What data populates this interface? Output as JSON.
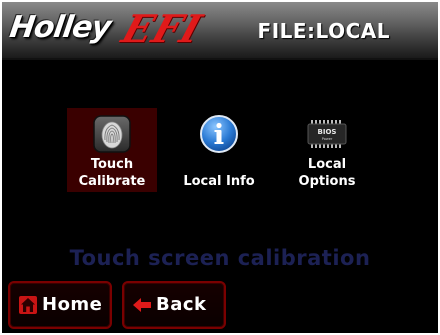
{
  "header": {
    "logo_brand": "Holley",
    "logo_product": "EFI",
    "title": "FILE:LOCAL"
  },
  "options": [
    {
      "id": "touch-calibrate",
      "label_line1": "Touch",
      "label_line2": "Calibrate",
      "icon": "fingerprint-icon",
      "selected": true
    },
    {
      "id": "local-info",
      "label_line1": "Local Info",
      "label_line2": "",
      "icon": "info-icon",
      "selected": false
    },
    {
      "id": "local-options",
      "label_line1": "Local",
      "label_line2": "Options",
      "icon": "bios-chip-icon",
      "icon_text_main": "BIOS",
      "icon_text_sub": "Power",
      "selected": false
    }
  ],
  "status": {
    "text": "Touch screen calibration"
  },
  "buttons": {
    "home_label": "Home",
    "home_icon": "house-icon",
    "back_label": "Back",
    "back_icon": "left-arrow-icon"
  },
  "colors": {
    "accent": "#e01a1a",
    "selected_bg": "#3a0000",
    "button_border": "#7a0000",
    "status_text": "#1c2154",
    "info_blue": "#2a7ad4"
  }
}
